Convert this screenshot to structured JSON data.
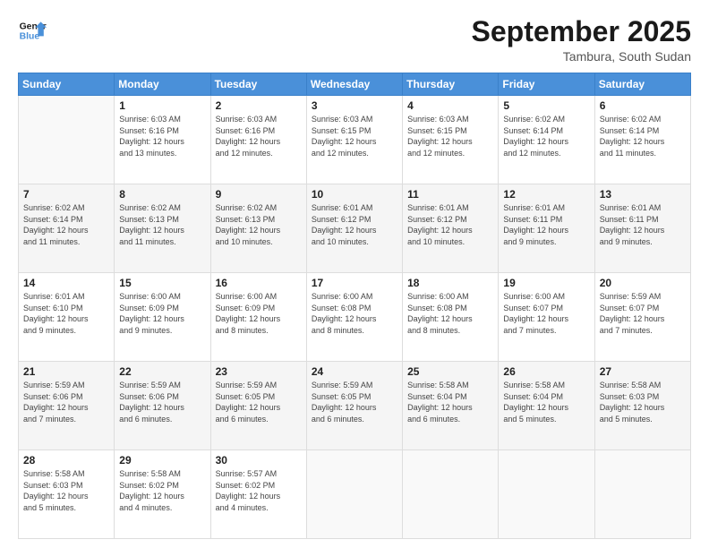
{
  "logo": {
    "line1": "General",
    "line2": "Blue"
  },
  "header": {
    "month": "September 2025",
    "location": "Tambura, South Sudan"
  },
  "weekdays": [
    "Sunday",
    "Monday",
    "Tuesday",
    "Wednesday",
    "Thursday",
    "Friday",
    "Saturday"
  ],
  "weeks": [
    [
      {
        "day": "",
        "info": ""
      },
      {
        "day": "1",
        "info": "Sunrise: 6:03 AM\nSunset: 6:16 PM\nDaylight: 12 hours\nand 13 minutes."
      },
      {
        "day": "2",
        "info": "Sunrise: 6:03 AM\nSunset: 6:16 PM\nDaylight: 12 hours\nand 12 minutes."
      },
      {
        "day": "3",
        "info": "Sunrise: 6:03 AM\nSunset: 6:15 PM\nDaylight: 12 hours\nand 12 minutes."
      },
      {
        "day": "4",
        "info": "Sunrise: 6:03 AM\nSunset: 6:15 PM\nDaylight: 12 hours\nand 12 minutes."
      },
      {
        "day": "5",
        "info": "Sunrise: 6:02 AM\nSunset: 6:14 PM\nDaylight: 12 hours\nand 12 minutes."
      },
      {
        "day": "6",
        "info": "Sunrise: 6:02 AM\nSunset: 6:14 PM\nDaylight: 12 hours\nand 11 minutes."
      }
    ],
    [
      {
        "day": "7",
        "info": "Sunrise: 6:02 AM\nSunset: 6:14 PM\nDaylight: 12 hours\nand 11 minutes."
      },
      {
        "day": "8",
        "info": "Sunrise: 6:02 AM\nSunset: 6:13 PM\nDaylight: 12 hours\nand 11 minutes."
      },
      {
        "day": "9",
        "info": "Sunrise: 6:02 AM\nSunset: 6:13 PM\nDaylight: 12 hours\nand 10 minutes."
      },
      {
        "day": "10",
        "info": "Sunrise: 6:01 AM\nSunset: 6:12 PM\nDaylight: 12 hours\nand 10 minutes."
      },
      {
        "day": "11",
        "info": "Sunrise: 6:01 AM\nSunset: 6:12 PM\nDaylight: 12 hours\nand 10 minutes."
      },
      {
        "day": "12",
        "info": "Sunrise: 6:01 AM\nSunset: 6:11 PM\nDaylight: 12 hours\nand 9 minutes."
      },
      {
        "day": "13",
        "info": "Sunrise: 6:01 AM\nSunset: 6:11 PM\nDaylight: 12 hours\nand 9 minutes."
      }
    ],
    [
      {
        "day": "14",
        "info": "Sunrise: 6:01 AM\nSunset: 6:10 PM\nDaylight: 12 hours\nand 9 minutes."
      },
      {
        "day": "15",
        "info": "Sunrise: 6:00 AM\nSunset: 6:09 PM\nDaylight: 12 hours\nand 9 minutes."
      },
      {
        "day": "16",
        "info": "Sunrise: 6:00 AM\nSunset: 6:09 PM\nDaylight: 12 hours\nand 8 minutes."
      },
      {
        "day": "17",
        "info": "Sunrise: 6:00 AM\nSunset: 6:08 PM\nDaylight: 12 hours\nand 8 minutes."
      },
      {
        "day": "18",
        "info": "Sunrise: 6:00 AM\nSunset: 6:08 PM\nDaylight: 12 hours\nand 8 minutes."
      },
      {
        "day": "19",
        "info": "Sunrise: 6:00 AM\nSunset: 6:07 PM\nDaylight: 12 hours\nand 7 minutes."
      },
      {
        "day": "20",
        "info": "Sunrise: 5:59 AM\nSunset: 6:07 PM\nDaylight: 12 hours\nand 7 minutes."
      }
    ],
    [
      {
        "day": "21",
        "info": "Sunrise: 5:59 AM\nSunset: 6:06 PM\nDaylight: 12 hours\nand 7 minutes."
      },
      {
        "day": "22",
        "info": "Sunrise: 5:59 AM\nSunset: 6:06 PM\nDaylight: 12 hours\nand 6 minutes."
      },
      {
        "day": "23",
        "info": "Sunrise: 5:59 AM\nSunset: 6:05 PM\nDaylight: 12 hours\nand 6 minutes."
      },
      {
        "day": "24",
        "info": "Sunrise: 5:59 AM\nSunset: 6:05 PM\nDaylight: 12 hours\nand 6 minutes."
      },
      {
        "day": "25",
        "info": "Sunrise: 5:58 AM\nSunset: 6:04 PM\nDaylight: 12 hours\nand 6 minutes."
      },
      {
        "day": "26",
        "info": "Sunrise: 5:58 AM\nSunset: 6:04 PM\nDaylight: 12 hours\nand 5 minutes."
      },
      {
        "day": "27",
        "info": "Sunrise: 5:58 AM\nSunset: 6:03 PM\nDaylight: 12 hours\nand 5 minutes."
      }
    ],
    [
      {
        "day": "28",
        "info": "Sunrise: 5:58 AM\nSunset: 6:03 PM\nDaylight: 12 hours\nand 5 minutes."
      },
      {
        "day": "29",
        "info": "Sunrise: 5:58 AM\nSunset: 6:02 PM\nDaylight: 12 hours\nand 4 minutes."
      },
      {
        "day": "30",
        "info": "Sunrise: 5:57 AM\nSunset: 6:02 PM\nDaylight: 12 hours\nand 4 minutes."
      },
      {
        "day": "",
        "info": ""
      },
      {
        "day": "",
        "info": ""
      },
      {
        "day": "",
        "info": ""
      },
      {
        "day": "",
        "info": ""
      }
    ]
  ]
}
